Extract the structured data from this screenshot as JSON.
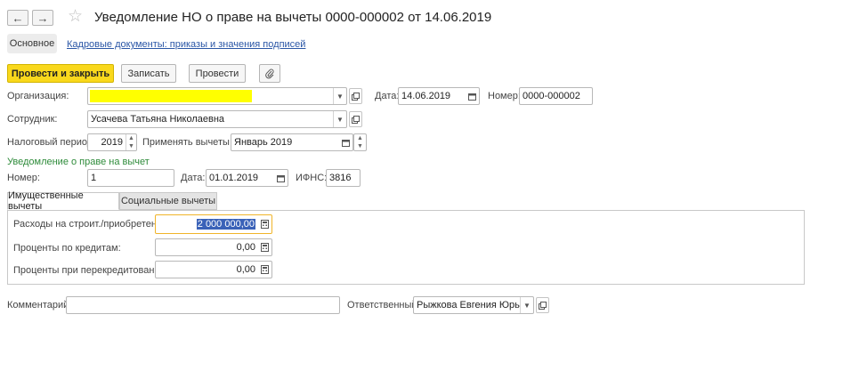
{
  "window": {
    "title": "Уведомление НО о праве на вычеты 0000-000002 от 14.06.2019"
  },
  "nav": {
    "back_icon": "←",
    "forward_icon": "→",
    "star_icon": "☆"
  },
  "page_tabs": {
    "main": "Основное",
    "link": "Кадровые документы: приказы и значения подписей"
  },
  "toolbar": {
    "post_close": "Провести и закрыть",
    "save": "Записать",
    "post": "Провести",
    "attach_icon": "paperclip"
  },
  "form": {
    "org_label": "Организация:",
    "org_value": "",
    "date_label": "Дата:",
    "date_value": "14.06.2019",
    "number_label": "Номер:",
    "number_value": "0000-000002",
    "employee_label": "Сотрудник:",
    "employee_value": "Усачева Татьяна Николаевна",
    "tax_period_label": "Налоговый период:",
    "tax_period_value": "2019",
    "apply_from_label": "Применять вычеты с:",
    "apply_from_value": "Январь 2019"
  },
  "notification": {
    "section_title": "Уведомление о праве на вычет",
    "number_label": "Номер:",
    "number_value": "1",
    "date_label": "Дата:",
    "date_value": "01.01.2019",
    "ifns_label": "ИФНС:",
    "ifns_value": "3816"
  },
  "deduction_tabs": [
    "Имущественные вычеты",
    "Социальные вычеты"
  ],
  "property": {
    "construction_label": "Расходы на строит./приобретение:",
    "construction_value": "2 000 000,00",
    "loan_interest_label": "Проценты по кредитам:",
    "loan_interest_value": "0,00",
    "refinance_label": "Проценты при перекредитовании:",
    "refinance_value": "0,00"
  },
  "footer": {
    "comment_label": "Комментарий:",
    "comment_value": "",
    "responsible_label": "Ответственный:",
    "responsible_value": "Рыжкова Евгения Юрьеві"
  },
  "colors": {
    "primary_button": "#f9d81c",
    "highlight": "#ffff00",
    "section_green": "#2e8b3a",
    "link_blue": "#2a56a6",
    "focus_border": "#f0b429"
  }
}
